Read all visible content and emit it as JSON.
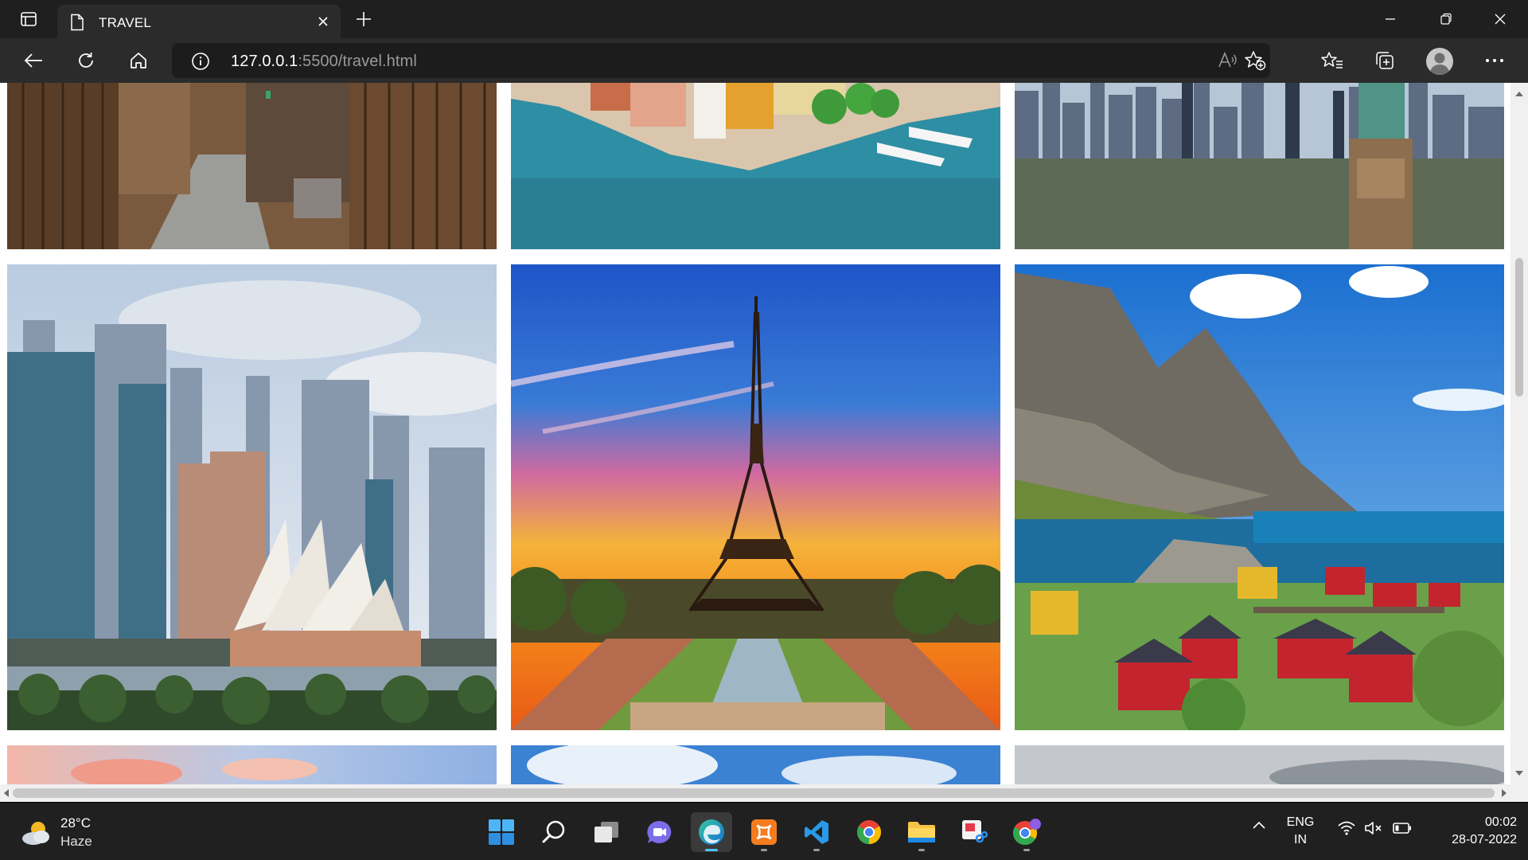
{
  "browser": {
    "tab": {
      "title": "TRAVEL"
    },
    "address": {
      "host": "127.0.0.1",
      "path": ":5500/travel.html"
    }
  },
  "page": {
    "gallery": [
      {
        "row": 1,
        "photos": [
          "kyoto-alley",
          "harbor-city",
          "new-york-skyline"
        ]
      },
      {
        "row": 2,
        "photos": [
          "sydney-opera-house",
          "eiffel-tower-sunset",
          "lofoten-village"
        ]
      },
      {
        "row": 3,
        "photos": [
          "sunset-sky",
          "blue-sky-clouds",
          "grey-clouds"
        ]
      }
    ]
  },
  "taskbar": {
    "weather": {
      "temp": "28°C",
      "condition": "Haze"
    },
    "apps": [
      "start",
      "search",
      "task-view",
      "teams-chat",
      "edge",
      "xampp",
      "vscode",
      "chrome",
      "file-explorer",
      "snipping-tool",
      "chrome-profile"
    ],
    "language": {
      "line1": "ENG",
      "line2": "IN"
    },
    "clock": {
      "time": "00:02",
      "date": "28-07-2022"
    }
  },
  "colors": {
    "titlebar": "#1f1f1f",
    "toolbar": "#2b2b2b",
    "taskbar": "#202020",
    "accent": "#4cc2ff"
  }
}
